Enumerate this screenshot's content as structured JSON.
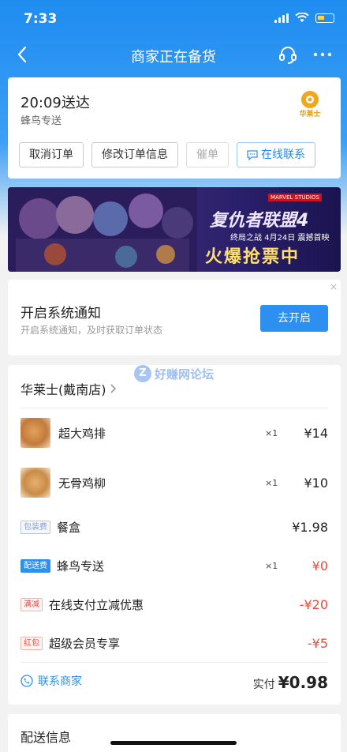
{
  "status": {
    "time": "7:33"
  },
  "nav": {
    "title": "商家正在备货"
  },
  "delivery": {
    "eta": "20:09送达",
    "rider": "蜂鸟专送",
    "brand_logo_text": "华莱士",
    "actions": [
      "取消订单",
      "修改订单信息",
      "催单",
      "在线联系"
    ]
  },
  "banner": {
    "title": "复仇者联盟4",
    "subtitle": "终局之战",
    "date": "4月24日 震撼首映",
    "cta": "火爆抢票中",
    "studio": "MARVEL STUDIOS"
  },
  "notify": {
    "title": "开启系统通知",
    "subtitle": "开启系统通知，及时获取订单状态",
    "button": "去开启",
    "close": "×"
  },
  "watermark": "好赚网论坛",
  "order": {
    "store": "华莱士(戴南店)",
    "items": [
      {
        "name": "超大鸡排",
        "qty": "×1",
        "price": "¥14"
      },
      {
        "name": "无骨鸡柳",
        "qty": "×1",
        "price": "¥10"
      }
    ],
    "fees": [
      {
        "tag": "包装费",
        "name": "餐盒",
        "qty": "",
        "price": "¥1.98"
      },
      {
        "tag": "配送费",
        "name": "蜂鸟专送",
        "qty": "×1",
        "price": "¥0"
      },
      {
        "tag": "满减",
        "name": "在线支付立减优惠",
        "qty": "",
        "price": "-¥20"
      },
      {
        "tag": "红包",
        "name": "超级会员专享",
        "qty": "",
        "price": "-¥5"
      }
    ],
    "contact": "联系商家",
    "paid_label": "实付",
    "paid_value": "¥0.98"
  },
  "shipping": {
    "title": "配送信息"
  },
  "colors": {
    "primary": "#2d8ff0",
    "red": "#f0483c",
    "header": "#1e8cf0"
  }
}
